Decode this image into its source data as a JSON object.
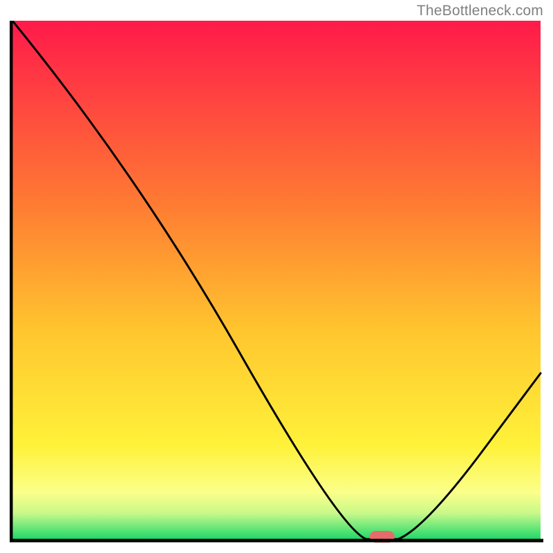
{
  "watermark": "TheBottleneck.com",
  "chart_data": {
    "type": "line",
    "title": "",
    "xlabel": "",
    "ylabel": "",
    "xlim": [
      0,
      100
    ],
    "ylim": [
      0,
      100
    ],
    "curve": [
      {
        "x": 0,
        "y": 100
      },
      {
        "x": 24,
        "y": 70
      },
      {
        "x": 62,
        "y": 2
      },
      {
        "x": 67,
        "y": 0
      },
      {
        "x": 73,
        "y": 0
      },
      {
        "x": 78,
        "y": 2
      },
      {
        "x": 100,
        "y": 32
      }
    ],
    "marker": {
      "x": 70,
      "y": 0
    },
    "gradient_stops": [
      {
        "offset": 0,
        "color": "#ff1a4a"
      },
      {
        "offset": 35,
        "color": "#ff7a33"
      },
      {
        "offset": 60,
        "color": "#ffc62e"
      },
      {
        "offset": 82,
        "color": "#fff23a"
      },
      {
        "offset": 91,
        "color": "#fbff8a"
      },
      {
        "offset": 95,
        "color": "#c8f98a"
      },
      {
        "offset": 100,
        "color": "#1fd86a"
      }
    ]
  }
}
